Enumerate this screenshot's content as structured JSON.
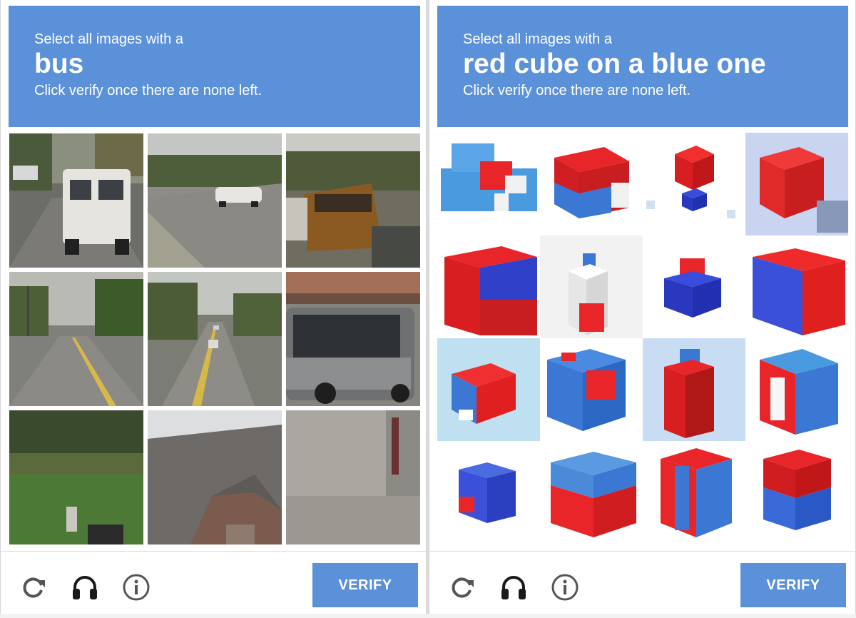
{
  "left": {
    "prompt": "Select all images with a",
    "target": "bus",
    "instruction": "Click verify once there are none left.",
    "verify_label": "VERIFY",
    "tile_count": 9
  },
  "right": {
    "prompt": "Select all images with a",
    "target": "red cube on a blue one",
    "instruction": "Click verify once there are none left.",
    "verify_label": "VERIFY",
    "tile_count": 16
  },
  "icons": {
    "reload": "reload-icon",
    "audio": "headphones-icon",
    "info": "info-icon"
  },
  "colors": {
    "accent": "#5b91d9",
    "cube_red": "#e8262a",
    "cube_blue": "#3a78d4"
  }
}
